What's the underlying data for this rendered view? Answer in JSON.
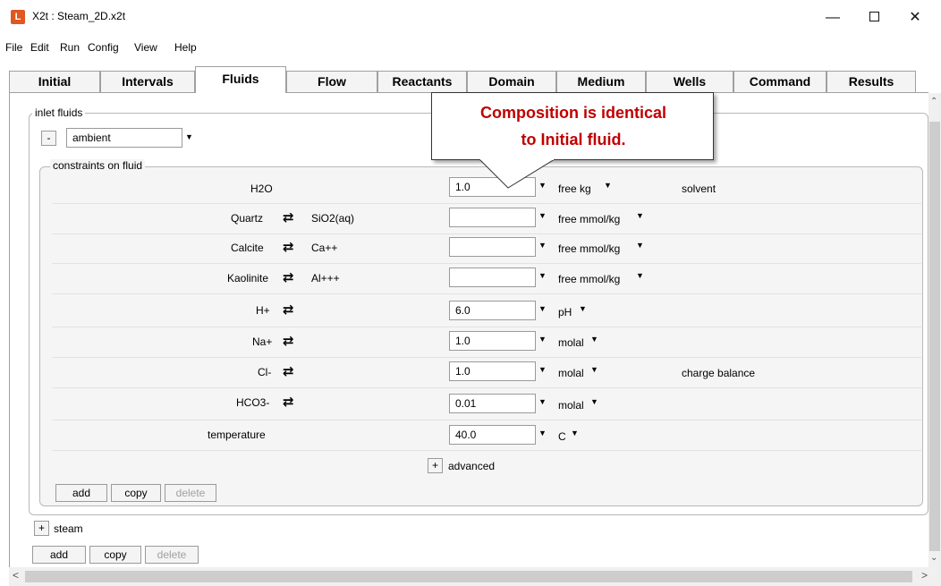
{
  "window": {
    "title": "X2t : Steam_2D.x2t",
    "app_icon_glyph": "L"
  },
  "menu": [
    "File",
    "Edit",
    "Run",
    "Config",
    "View",
    "Help"
  ],
  "tabs": [
    "Initial",
    "Intervals",
    "Fluids",
    "Flow",
    "Reactants",
    "Domain",
    "Medium",
    "Wells",
    "Command",
    "Results"
  ],
  "active_tab": "Fluids",
  "inlet_fluids": {
    "group_label": "inlet fluids",
    "collapse_symbol": "-",
    "fluid_name": "ambient",
    "constraints_label": "constraints on fluid",
    "rows": [
      {
        "species": "H2O",
        "swap": false,
        "swap_species": "",
        "value": "1.0",
        "unit": "free kg",
        "note": "solvent"
      },
      {
        "species": "Quartz",
        "swap": true,
        "swap_species": "SiO2(aq)",
        "value": "",
        "unit": "free mmol/kg",
        "note": ""
      },
      {
        "species": "Calcite",
        "swap": true,
        "swap_species": "Ca++",
        "value": "",
        "unit": "free mmol/kg",
        "note": ""
      },
      {
        "species": "Kaolinite",
        "swap": true,
        "swap_species": "Al+++",
        "value": "",
        "unit": "free mmol/kg",
        "note": ""
      },
      {
        "species": "H+",
        "swap": true,
        "swap_species": "",
        "value": "6.0",
        "unit": "pH",
        "note": ""
      },
      {
        "species": "Na+",
        "swap": true,
        "swap_species": "",
        "value": "1.0",
        "unit": "molal",
        "note": ""
      },
      {
        "species": "Cl-",
        "swap": true,
        "swap_species": "",
        "value": "1.0",
        "unit": "molal",
        "note": "charge balance"
      },
      {
        "species": "HCO3-",
        "swap": true,
        "swap_species": "",
        "value": "0.01",
        "unit": "molal",
        "note": ""
      },
      {
        "species": "temperature",
        "swap": false,
        "swap_species": "",
        "value": "40.0",
        "unit": "C",
        "note": ""
      }
    ],
    "advanced_symbol": "+",
    "advanced_label": "advanced",
    "inner_buttons": {
      "add": "add",
      "copy": "copy",
      "delete": "delete"
    }
  },
  "steam": {
    "expand_symbol": "+",
    "label": "steam"
  },
  "outer_buttons": {
    "add": "add",
    "copy": "copy",
    "delete": "delete"
  },
  "callout": {
    "line1": "Composition is identical",
    "line2": "to Initial fluid.",
    "color": "#c00000"
  }
}
